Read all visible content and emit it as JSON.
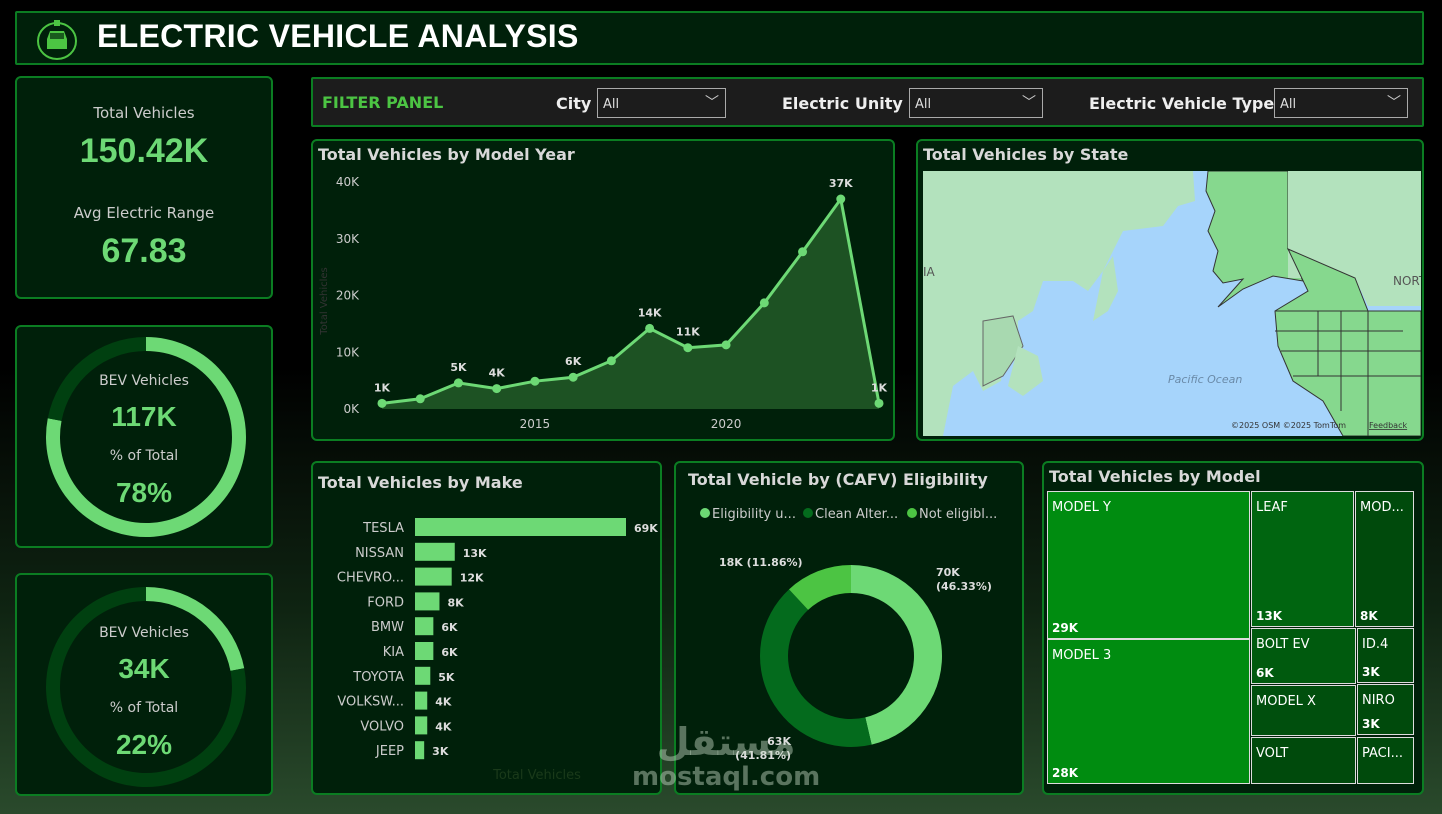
{
  "header": {
    "title": "ELECTRIC VEHICLE ANALYSIS",
    "logo_icon": "ev-car-plug-icon"
  },
  "kpi": {
    "total_label": "Total Vehicles",
    "total_value": "150.42K",
    "range_label": "Avg Electric Range",
    "range_value": "67.83"
  },
  "donut_cards": [
    {
      "label": "BEV Vehicles",
      "value": "117K",
      "pct_label": "% of Total",
      "pct": "78%",
      "fraction": 0.78
    },
    {
      "label": "BEV Vehicles",
      "value": "34K",
      "pct_label": "% of Total",
      "pct": "22%",
      "fraction": 0.22
    }
  ],
  "filter": {
    "title": "FILTER PANEL",
    "filters": [
      {
        "label": "City",
        "value": "All"
      },
      {
        "label": "Electric Unity",
        "value": "All"
      },
      {
        "label": "Electric Vehicle Type",
        "value": "All"
      }
    ]
  },
  "colors": {
    "light": "#6dd975",
    "mid": "#4cc443",
    "dark": "#046b1d",
    "panel": "#00200a",
    "border": "#0b7d22"
  },
  "map": {
    "title": "Total Vehicles by State",
    "ocean_label": "Pacific Ocean",
    "region_label": "NORTH A",
    "edge_label": "IA",
    "credits": "©2025 OSM  ©2025 TomTom",
    "feedback": "Feedback"
  },
  "treemap": {
    "title": "Total Vehicles by Model",
    "items": [
      {
        "name": "MODEL Y",
        "value": "29K"
      },
      {
        "name": "MODEL 3",
        "value": "28K"
      },
      {
        "name": "LEAF",
        "value": "13K"
      },
      {
        "name": "MOD...",
        "value": "8K"
      },
      {
        "name": "BOLT EV",
        "value": "6K"
      },
      {
        "name": "ID.4",
        "value": "3K"
      },
      {
        "name": "MODEL X",
        "value": ""
      },
      {
        "name": "NIRO",
        "value": "3K"
      },
      {
        "name": "VOLT",
        "value": ""
      },
      {
        "name": "PACI...",
        "value": ""
      }
    ]
  },
  "watermark": {
    "arabic": "مستقل",
    "latin": "mostaql.com"
  },
  "chart_data": [
    {
      "type": "area",
      "title": "Total Vehicles by Model Year",
      "ylabel": "Total Vehicles",
      "ylim": [
        0,
        40000
      ],
      "yticks": [
        "0K",
        "10K",
        "20K",
        "30K",
        "40K"
      ],
      "xticks": [
        "2015",
        "2020"
      ],
      "x": [
        2011,
        2012,
        2013,
        2014,
        2015,
        2016,
        2017,
        2018,
        2019,
        2020,
        2021,
        2022,
        2023,
        2024
      ],
      "values": [
        1000,
        1800,
        4600,
        3600,
        4900,
        5600,
        8500,
        14200,
        10800,
        11300,
        18700,
        27700,
        37000,
        1000
      ],
      "labels": [
        "1K",
        "",
        "5K",
        "4K",
        "",
        "6K",
        "",
        "14K",
        "11K",
        "",
        "",
        "",
        "37K",
        "1K"
      ]
    },
    {
      "type": "bar",
      "title": "Total Vehicles by Make",
      "xlabel": "Total Vehicles",
      "categories": [
        "TESLA",
        "NISSAN",
        "CHEVRO...",
        "FORD",
        "BMW",
        "KIA",
        "TOYOTA",
        "VOLKSW...",
        "VOLVO",
        "JEEP"
      ],
      "values": [
        69000,
        13000,
        12000,
        8000,
        6000,
        6000,
        5000,
        4000,
        4000,
        3000
      ],
      "labels": [
        "69K",
        "13K",
        "12K",
        "8K",
        "6K",
        "6K",
        "5K",
        "4K",
        "4K",
        "3K"
      ]
    },
    {
      "type": "pie",
      "title": "Total Vehicle by (CAFV) Eligibility",
      "legend": [
        "Eligibility u...",
        "Clean Alter...",
        "Not eligibl..."
      ],
      "legend_position": "top",
      "values": [
        70000,
        63000,
        18000
      ],
      "percents": [
        46.33,
        41.81,
        11.86
      ],
      "labels": [
        "70K",
        "63K",
        "18K (11.86%)"
      ],
      "sublabels": [
        "(46.33%)",
        "(41.81%)",
        ""
      ]
    }
  ]
}
